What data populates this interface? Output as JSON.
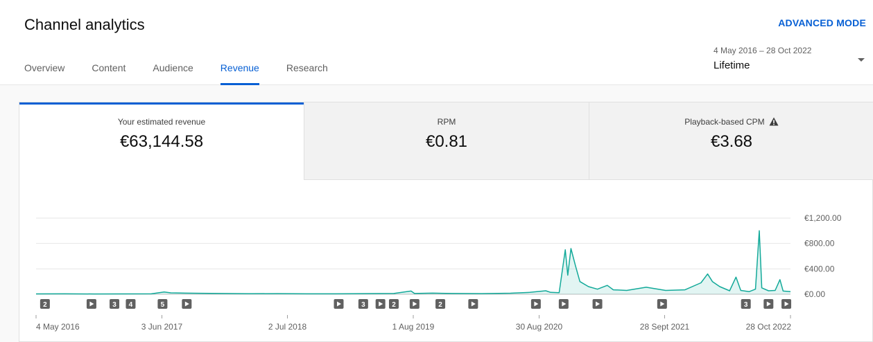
{
  "header": {
    "title": "Channel analytics",
    "advanced_mode": "ADVANCED MODE",
    "tabs": [
      {
        "label": "Overview",
        "active": false
      },
      {
        "label": "Content",
        "active": false
      },
      {
        "label": "Audience",
        "active": false
      },
      {
        "label": "Revenue",
        "active": true
      },
      {
        "label": "Research",
        "active": false
      }
    ],
    "date_range": {
      "range": "4 May 2016 – 28 Oct 2022",
      "period": "Lifetime"
    }
  },
  "metrics": [
    {
      "label": "Your estimated revenue",
      "value": "€63,144.58",
      "selected": true
    },
    {
      "label": "RPM",
      "value": "€0.81",
      "selected": false
    },
    {
      "label": "Playback-based CPM",
      "value": "€3.68",
      "selected": false,
      "icon": "warning-icon"
    }
  ],
  "colors": {
    "accent": "#065fd4",
    "series": "#12a999",
    "marker": "#606060"
  },
  "chart_data": {
    "type": "area",
    "title": "",
    "xlabel": "",
    "ylabel": "",
    "ylim": [
      0,
      1200
    ],
    "yticks": [
      {
        "value": 0,
        "label": "€0.00"
      },
      {
        "value": 400,
        "label": "€400.00"
      },
      {
        "value": 800,
        "label": "€800.00"
      },
      {
        "value": 1200,
        "label": "€1,200.00"
      }
    ],
    "xlim": [
      "2016-05-04",
      "2022-10-28"
    ],
    "xticks": [
      {
        "date": "2016-05-04",
        "label": "4 May 2016"
      },
      {
        "date": "2017-06-03",
        "label": "3 Jun 2017"
      },
      {
        "date": "2018-07-02",
        "label": "2 Jul 2018"
      },
      {
        "date": "2019-08-01",
        "label": "1 Aug 2019"
      },
      {
        "date": "2020-08-30",
        "label": "30 Aug 2020"
      },
      {
        "date": "2021-09-28",
        "label": "28 Sept 2021"
      },
      {
        "date": "2022-10-28",
        "label": "28 Oct 2022"
      }
    ],
    "grid": true,
    "series": [
      {
        "points": [
          [
            "2016-05-04",
            5
          ],
          [
            "2016-08-01",
            6
          ],
          [
            "2016-11-01",
            4
          ],
          [
            "2017-02-01",
            5
          ],
          [
            "2017-05-01",
            7
          ],
          [
            "2017-06-10",
            35
          ],
          [
            "2017-07-01",
            22
          ],
          [
            "2017-08-15",
            18
          ],
          [
            "2017-10-01",
            15
          ],
          [
            "2017-12-01",
            12
          ],
          [
            "2018-03-01",
            8
          ],
          [
            "2018-06-01",
            10
          ],
          [
            "2018-09-01",
            7
          ],
          [
            "2018-12-01",
            6
          ],
          [
            "2019-03-01",
            10
          ],
          [
            "2019-06-01",
            12
          ],
          [
            "2019-07-25",
            50
          ],
          [
            "2019-08-05",
            12
          ],
          [
            "2019-10-01",
            18
          ],
          [
            "2019-12-01",
            12
          ],
          [
            "2020-03-01",
            10
          ],
          [
            "2020-06-01",
            16
          ],
          [
            "2020-08-01",
            30
          ],
          [
            "2020-09-20",
            55
          ],
          [
            "2020-10-05",
            30
          ],
          [
            "2020-11-01",
            25
          ],
          [
            "2020-11-20",
            700
          ],
          [
            "2020-11-28",
            300
          ],
          [
            "2020-12-08",
            720
          ],
          [
            "2020-12-22",
            450
          ],
          [
            "2021-01-05",
            200
          ],
          [
            "2021-02-01",
            120
          ],
          [
            "2021-03-01",
            80
          ],
          [
            "2021-04-01",
            140
          ],
          [
            "2021-04-20",
            70
          ],
          [
            "2021-06-01",
            60
          ],
          [
            "2021-08-01",
            110
          ],
          [
            "2021-10-01",
            60
          ],
          [
            "2021-12-01",
            70
          ],
          [
            "2022-01-20",
            180
          ],
          [
            "2022-02-10",
            320
          ],
          [
            "2022-02-25",
            200
          ],
          [
            "2022-03-20",
            120
          ],
          [
            "2022-04-20",
            55
          ],
          [
            "2022-05-10",
            270
          ],
          [
            "2022-05-25",
            60
          ],
          [
            "2022-06-20",
            40
          ],
          [
            "2022-07-10",
            80
          ],
          [
            "2022-07-22",
            1000
          ],
          [
            "2022-07-30",
            100
          ],
          [
            "2022-08-20",
            55
          ],
          [
            "2022-09-10",
            60
          ],
          [
            "2022-09-25",
            230
          ],
          [
            "2022-10-05",
            50
          ],
          [
            "2022-10-28",
            40
          ]
        ]
      }
    ],
    "markers": [
      {
        "date": "2016-06-01",
        "label": "2"
      },
      {
        "date": "2016-10-25",
        "icon": "play-icon"
      },
      {
        "date": "2017-01-05",
        "label": "3"
      },
      {
        "date": "2017-02-25",
        "label": "4"
      },
      {
        "date": "2017-06-05",
        "label": "5"
      },
      {
        "date": "2017-08-20",
        "icon": "play-icon"
      },
      {
        "date": "2018-12-10",
        "icon": "play-icon"
      },
      {
        "date": "2019-02-25",
        "label": "3"
      },
      {
        "date": "2019-04-20",
        "icon": "play-icon"
      },
      {
        "date": "2019-06-01",
        "label": "2"
      },
      {
        "date": "2019-08-05",
        "icon": "play-icon"
      },
      {
        "date": "2019-10-25",
        "label": "2"
      },
      {
        "date": "2020-02-05",
        "icon": "play-icon"
      },
      {
        "date": "2020-08-20",
        "icon": "play-icon"
      },
      {
        "date": "2020-11-15",
        "icon": "play-icon"
      },
      {
        "date": "2021-03-01",
        "icon": "play-icon"
      },
      {
        "date": "2021-09-20",
        "icon": "play-icon"
      },
      {
        "date": "2022-06-10",
        "label": "3"
      },
      {
        "date": "2022-08-20",
        "icon": "play-icon"
      },
      {
        "date": "2022-10-15",
        "icon": "play-icon"
      }
    ]
  }
}
